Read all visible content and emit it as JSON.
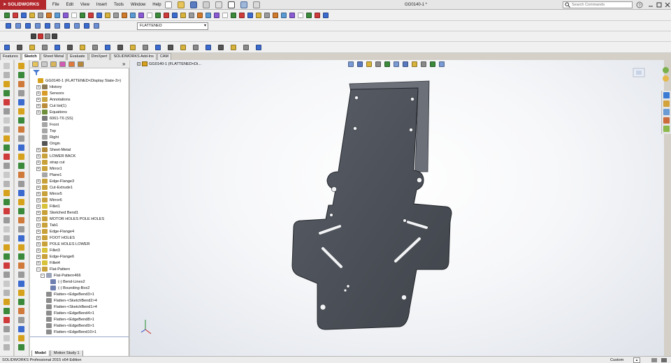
{
  "app": {
    "brand": "SOLIDWORKS",
    "document_title": "GG0140-1 *",
    "menus": [
      "File",
      "Edit",
      "View",
      "Insert",
      "Tools",
      "Window",
      "Help"
    ],
    "search_placeholder": "Search Commands"
  },
  "toolbar": {
    "configuration": "FLATTENED"
  },
  "command_manager_tabs": [
    {
      "label": "Features",
      "active": false
    },
    {
      "label": "Sketch",
      "active": true
    },
    {
      "label": "Sheet Metal",
      "active": false
    },
    {
      "label": "Evaluate",
      "active": false
    },
    {
      "label": "DimXpert",
      "active": false
    },
    {
      "label": "SOLIDWORKS Add-Ins",
      "active": false
    },
    {
      "label": "CAM",
      "active": false
    }
  ],
  "feature_tree": {
    "items": [
      {
        "label": "GG0140-1  (FLATTENED<Display State-3>)",
        "level": 0,
        "expand": "none",
        "icon": "part-icon",
        "color": "#d6a21e"
      },
      {
        "label": "History",
        "level": 1,
        "expand": "+",
        "icon": "history-icon",
        "color": "#8a7a55"
      },
      {
        "label": "Sensors",
        "level": 1,
        "expand": "+",
        "icon": "sensor-icon",
        "color": "#d89b2a"
      },
      {
        "label": "Annotations",
        "level": 1,
        "expand": "+",
        "icon": "annotation-icon",
        "color": "#c9a640"
      },
      {
        "label": "Cut list(1)",
        "level": 1,
        "expand": "+",
        "icon": "cutlist-icon",
        "color": "#b98c3a"
      },
      {
        "label": "Equations",
        "level": 1,
        "expand": "+",
        "icon": "equation-icon",
        "color": "#6f8f3a"
      },
      {
        "label": "6061-T6 (SS)",
        "level": 1,
        "expand": "none",
        "icon": "material-icon",
        "color": "#7a7a7a"
      },
      {
        "label": "Front",
        "level": 1,
        "expand": "none",
        "icon": "plane-icon",
        "color": "#a6a6a6"
      },
      {
        "label": "Top",
        "level": 1,
        "expand": "none",
        "icon": "plane-icon",
        "color": "#a6a6a6"
      },
      {
        "label": "Right",
        "level": 1,
        "expand": "none",
        "icon": "plane-icon",
        "color": "#a6a6a6"
      },
      {
        "label": "Origin",
        "level": 1,
        "expand": "none",
        "icon": "origin-icon",
        "color": "#555555"
      },
      {
        "label": "Sheet-Metal",
        "level": 1,
        "expand": "+",
        "icon": "sheetmetal-icon",
        "color": "#b28a3a"
      },
      {
        "label": "LOWER BACK",
        "level": 1,
        "expand": "+",
        "icon": "feature-icon",
        "color": "#c9a13a"
      },
      {
        "label": "strap cut",
        "level": 1,
        "expand": "+",
        "icon": "cut-icon",
        "color": "#c9a13a"
      },
      {
        "label": "Mirror1",
        "level": 1,
        "expand": "+",
        "icon": "mirror-icon",
        "color": "#c9a13a"
      },
      {
        "label": "Plane1",
        "level": 1,
        "expand": "none",
        "icon": "plane-icon",
        "color": "#a6a6a6"
      },
      {
        "label": "Edge-Flange3",
        "level": 1,
        "expand": "+",
        "icon": "flange-icon",
        "color": "#c9a13a"
      },
      {
        "label": "Cut-Extrude1",
        "level": 1,
        "expand": "+",
        "icon": "cut-icon",
        "color": "#c9a13a"
      },
      {
        "label": "Mirror5",
        "level": 1,
        "expand": "+",
        "icon": "mirror-icon",
        "color": "#c9a13a"
      },
      {
        "label": "Mirror6",
        "level": 1,
        "expand": "+",
        "icon": "mirror-icon",
        "color": "#c9a13a"
      },
      {
        "label": "Fillet1",
        "level": 1,
        "expand": "+",
        "icon": "fillet-icon",
        "color": "#d7c23a"
      },
      {
        "label": "Sketched Bend1",
        "level": 1,
        "expand": "+",
        "icon": "bend-icon",
        "color": "#c9a13a"
      },
      {
        "label": "MOTOR HOLES POLE HOLES",
        "level": 1,
        "expand": "+",
        "icon": "feature-icon",
        "color": "#c9a13a"
      },
      {
        "label": "Tab1",
        "level": 1,
        "expand": "+",
        "icon": "tab-icon",
        "color": "#c9a13a"
      },
      {
        "label": "Edge-Flange4",
        "level": 1,
        "expand": "+",
        "icon": "flange-icon",
        "color": "#c9a13a"
      },
      {
        "label": "FOOT HOLES",
        "level": 1,
        "expand": "+",
        "icon": "feature-icon",
        "color": "#c9a13a"
      },
      {
        "label": "POLE HOLES LOWER",
        "level": 1,
        "expand": "+",
        "icon": "feature-icon",
        "color": "#c9a13a"
      },
      {
        "label": "Fillet3",
        "level": 1,
        "expand": "+",
        "icon": "fillet-icon",
        "color": "#d7c23a"
      },
      {
        "label": "Edge-Flange6",
        "level": 1,
        "expand": "+",
        "icon": "flange-icon",
        "color": "#c9a13a"
      },
      {
        "label": "Fillet4",
        "level": 1,
        "expand": "+",
        "icon": "fillet-icon",
        "color": "#d7c23a"
      },
      {
        "label": "Flat-Pattern",
        "level": 1,
        "expand": "-",
        "icon": "flatpattern-icon",
        "color": "#c9a13a"
      },
      {
        "label": "Flat-Pattern466",
        "level": 2,
        "expand": "-",
        "icon": "flatpattern-icon",
        "color": "#9aa3b8"
      },
      {
        "label": "(-) Bend-Lines2",
        "level": 3,
        "expand": "none",
        "icon": "sketch-icon",
        "color": "#6f7fb0"
      },
      {
        "label": "(-) Bounding-Box2",
        "level": 3,
        "expand": "none",
        "icon": "sketch-icon",
        "color": "#6f7fb0"
      },
      {
        "label": "Flatten-<EdgeBend3>1",
        "level": 2,
        "expand": "none",
        "icon": "flatten-icon",
        "color": "#8c8c8c"
      },
      {
        "label": "Flatten-<SketchBend2>4",
        "level": 2,
        "expand": "none",
        "icon": "flatten-icon",
        "color": "#8c8c8c"
      },
      {
        "label": "Flatten-<SketchBend1>4",
        "level": 2,
        "expand": "none",
        "icon": "flatten-icon",
        "color": "#8c8c8c"
      },
      {
        "label": "Flatten-<EdgeBend4>1",
        "level": 2,
        "expand": "none",
        "icon": "flatten-icon",
        "color": "#8c8c8c"
      },
      {
        "label": "Flatten-<EdgeBend8>1",
        "level": 2,
        "expand": "none",
        "icon": "flatten-icon",
        "color": "#8c8c8c"
      },
      {
        "label": "Flatten-<EdgeBend9>1",
        "level": 2,
        "expand": "none",
        "icon": "flatten-icon",
        "color": "#8c8c8c"
      },
      {
        "label": "Flatten-<EdgeBend10>1",
        "level": 2,
        "expand": "none",
        "icon": "flatten-icon",
        "color": "#8c8c8c"
      }
    ]
  },
  "viewport": {
    "breadcrumb": "GG0140-1  (FLATTENED<Di..."
  },
  "bottom_tabs": [
    {
      "label": "Model",
      "active": true
    },
    {
      "label": "Motion Study 1",
      "active": false
    }
  ],
  "status": {
    "left": "SOLIDWORKS Professional 2015 x64 Edition",
    "units": "Custom"
  },
  "colors": {
    "brand": "#b3282d",
    "part_fill": "#4b4f57",
    "part_edge": "#2f3238"
  }
}
